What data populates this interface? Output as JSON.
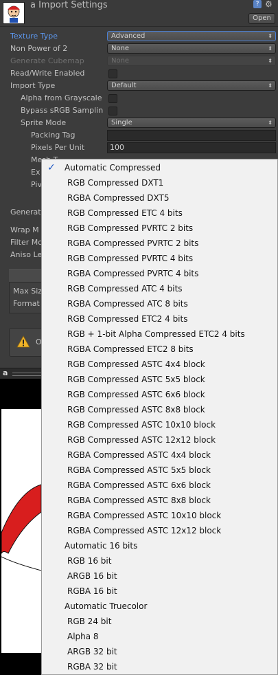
{
  "header": {
    "title": "a Import Settings",
    "open_label": "Open",
    "help_label": "?"
  },
  "fields": [
    {
      "label": "Texture Type",
      "kind": "popup",
      "value": "Advanced",
      "highlight": true
    },
    {
      "label": "Non Power of 2",
      "kind": "popup",
      "value": "None"
    },
    {
      "label": "Generate Cubemap",
      "kind": "popup",
      "value": "None",
      "disabled": true
    },
    {
      "label": "Read/Write Enabled",
      "kind": "check"
    },
    {
      "label": "Import Type",
      "kind": "popup",
      "value": "Default"
    },
    {
      "label": "Alpha from Grayscale",
      "kind": "check"
    },
    {
      "label": "Bypass sRGB Samplin",
      "kind": "check"
    },
    {
      "label": "Sprite Mode",
      "kind": "popup",
      "value": "Single"
    },
    {
      "label": "Packing Tag",
      "kind": "text",
      "value": ""
    },
    {
      "label": "Pixels Per Unit",
      "kind": "text",
      "value": "100"
    },
    {
      "label": "Mesh T",
      "kind": "label"
    },
    {
      "label": "Ex",
      "kind": "label"
    },
    {
      "label": "Piv",
      "kind": "label"
    },
    {
      "label": "Generat",
      "kind": "label"
    },
    {
      "label": "Wrap M",
      "kind": "label"
    },
    {
      "label": "Filter Mo",
      "kind": "label"
    },
    {
      "label": "Aniso Le",
      "kind": "label"
    },
    {
      "label": "Max Siz",
      "kind": "label"
    },
    {
      "label": "Format",
      "kind": "label"
    }
  ],
  "warning": {
    "text": "O"
  },
  "preview": {
    "label": "a"
  },
  "menu": {
    "selected": "Automatic Compressed",
    "check_glyph": "✓",
    "items": [
      {
        "label": "Automatic Compressed",
        "level": 1
      },
      {
        "label": "RGB Compressed DXT1",
        "level": 2
      },
      {
        "label": "RGBA Compressed DXT5",
        "level": 2
      },
      {
        "label": "RGB Compressed ETC 4 bits",
        "level": 2
      },
      {
        "label": "RGB Compressed PVRTC 2 bits",
        "level": 2
      },
      {
        "label": "RGBA Compressed PVRTC 2 bits",
        "level": 2
      },
      {
        "label": "RGB Compressed PVRTC 4 bits",
        "level": 2
      },
      {
        "label": "RGBA Compressed PVRTC 4 bits",
        "level": 2
      },
      {
        "label": "RGB Compressed ATC 4 bits",
        "level": 2
      },
      {
        "label": "RGBA Compressed ATC 8 bits",
        "level": 2
      },
      {
        "label": "RGB Compressed ETC2 4 bits",
        "level": 2
      },
      {
        "label": "RGB + 1-bit Alpha Compressed ETC2 4 bits",
        "level": 2
      },
      {
        "label": "RGBA Compressed ETC2 8 bits",
        "level": 2
      },
      {
        "label": "RGB Compressed ASTC 4x4 block",
        "level": 2
      },
      {
        "label": "RGB Compressed ASTC 5x5 block",
        "level": 2
      },
      {
        "label": "RGB Compressed ASTC 6x6 block",
        "level": 2
      },
      {
        "label": "RGB Compressed ASTC 8x8 block",
        "level": 2
      },
      {
        "label": "RGB Compressed ASTC 10x10 block",
        "level": 2
      },
      {
        "label": "RGB Compressed ASTC 12x12 block",
        "level": 2
      },
      {
        "label": "RGBA Compressed ASTC 4x4 block",
        "level": 2
      },
      {
        "label": "RGBA Compressed ASTC 5x5 block",
        "level": 2
      },
      {
        "label": "RGBA Compressed ASTC 6x6 block",
        "level": 2
      },
      {
        "label": "RGBA Compressed ASTC 8x8 block",
        "level": 2
      },
      {
        "label": "RGBA Compressed ASTC 10x10 block",
        "level": 2
      },
      {
        "label": "RGBA Compressed ASTC 12x12 block",
        "level": 2
      },
      {
        "label": "Automatic 16 bits",
        "level": 1
      },
      {
        "label": "RGB 16 bit",
        "level": 2
      },
      {
        "label": "ARGB 16 bit",
        "level": 2
      },
      {
        "label": "RGBA 16 bit",
        "level": 2
      },
      {
        "label": "Automatic Truecolor",
        "level": 1
      },
      {
        "label": "RGB 24 bit",
        "level": 2
      },
      {
        "label": "Alpha 8",
        "level": 2
      },
      {
        "label": "ARGB 32 bit",
        "level": 2
      },
      {
        "label": "RGBA 32 bit",
        "level": 2
      }
    ]
  },
  "colors": {
    "background": "#3c3c3c",
    "label": "#c2c2c2",
    "highlight": "#5d98ef",
    "menu_background": "#f1f1f1",
    "checkmark": "#1d57c4",
    "warning": "#f0b429"
  }
}
